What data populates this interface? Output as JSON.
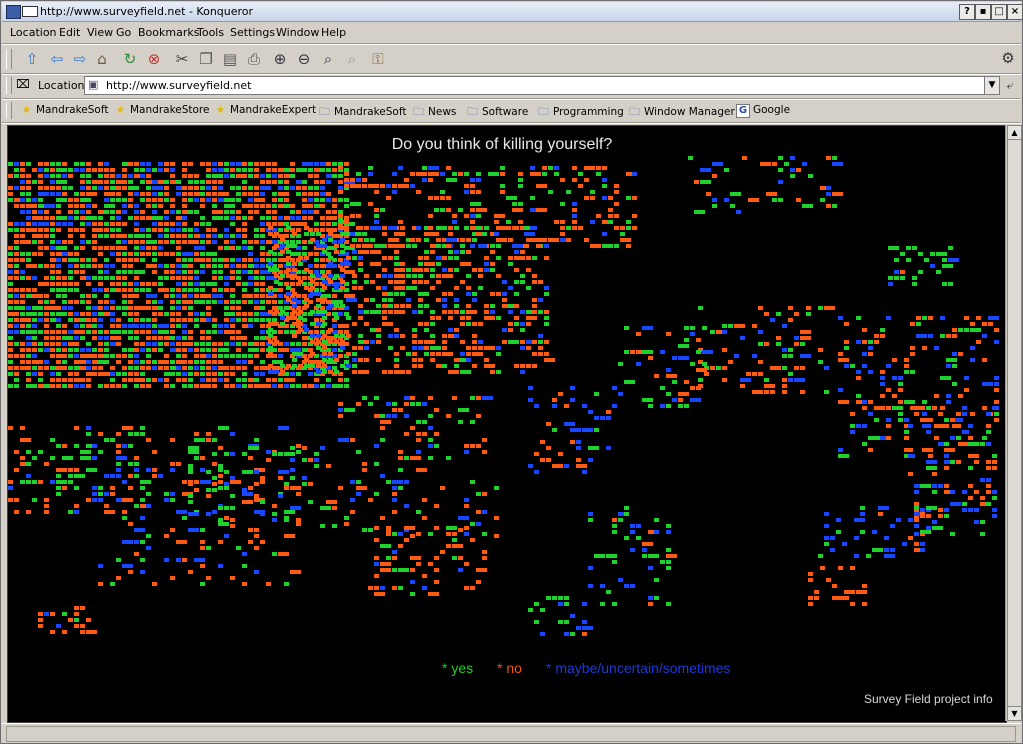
{
  "window": {
    "title": "http://www.surveyfield.net - Konqueror",
    "controls": [
      "?",
      "▪",
      "□",
      "×"
    ]
  },
  "menu": [
    "Location",
    "Edit",
    "View",
    "Go",
    "Bookmarks",
    "Tools",
    "Settings",
    "Window",
    "Help"
  ],
  "toolbar": {
    "icons": [
      "up-arrow-icon",
      "back-arrow-icon",
      "forward-arrow-icon",
      "home-icon",
      "reload-icon",
      "stop-icon",
      "cut-icon",
      "copy-icon",
      "paste-icon",
      "print-icon",
      "zoom-in-icon",
      "zoom-out-icon",
      "find-icon",
      "find-next-icon",
      "security-lock-icon"
    ]
  },
  "location": {
    "label": "Location",
    "url": "http://www.surveyfield.net"
  },
  "bookmarks": [
    {
      "label": "MandrakeSoft",
      "icon": "star-icon"
    },
    {
      "label": "MandrakeStore",
      "icon": "star-icon"
    },
    {
      "label": "MandrakeExpert",
      "icon": "star-icon"
    },
    {
      "label": "MandrakeSoft",
      "icon": "folder-icon"
    },
    {
      "label": "News",
      "icon": "folder-icon"
    },
    {
      "label": "Software",
      "icon": "folder-icon"
    },
    {
      "label": "Programming",
      "icon": "folder-icon"
    },
    {
      "label": "Window Manager",
      "icon": "folder-icon"
    },
    {
      "label": "Google",
      "icon": "google-icon"
    }
  ],
  "page": {
    "title": "Do you think of killing yourself?",
    "legend": [
      {
        "label": "* yes",
        "color": "#22cc22"
      },
      {
        "label": "* no",
        "color": "#ee5511"
      },
      {
        "label": "* maybe/uncertain/sometimes",
        "color": "#1c3ad8"
      }
    ],
    "footer_link": "Survey Field project info"
  },
  "colors": {
    "yes": "#1fd12c",
    "no": "#ff5a14",
    "maybe": "#1747ff",
    "background": "#000000"
  }
}
